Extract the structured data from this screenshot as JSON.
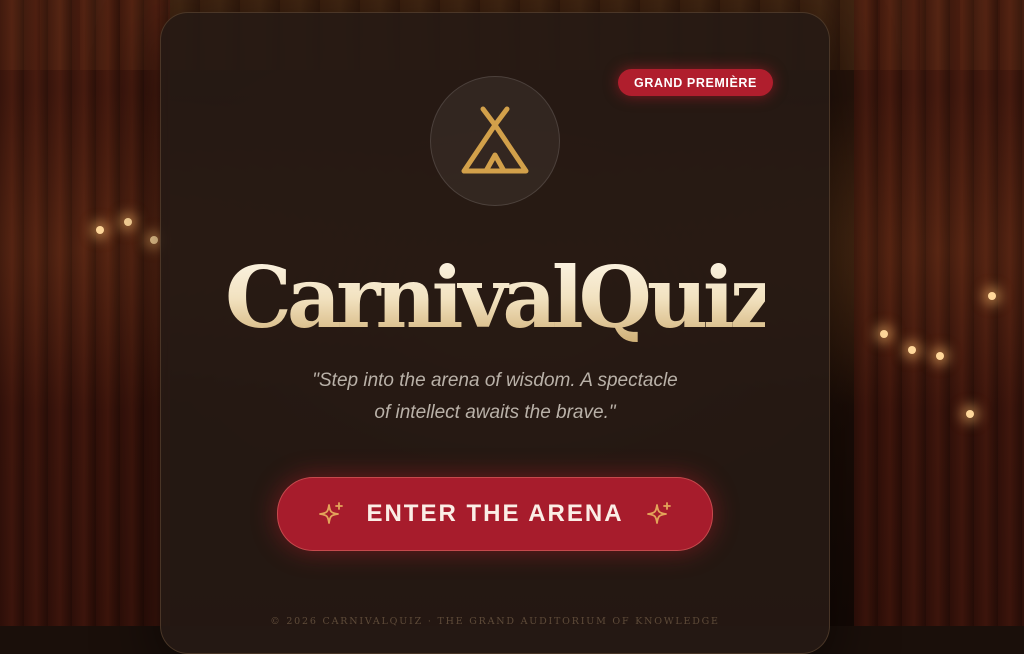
{
  "badge": {
    "label": "GRAND PREMIÈRE"
  },
  "emblem": {
    "icon": "tent-icon",
    "color": "#d2a04a"
  },
  "title": "CarnivalQuiz",
  "tagline": {
    "line1": "\"Step into the arena of wisdom. A spectacle",
    "line2": "of intellect awaits the brave.\""
  },
  "cta": {
    "label": "ENTER THE ARENA",
    "icon": "sparkle-icon",
    "color": "#a71c2c"
  },
  "footer": {
    "text": "© 2026 CARNIVALQUIZ · THE GRAND AUDITORIUM OF KNOWLEDGE"
  }
}
